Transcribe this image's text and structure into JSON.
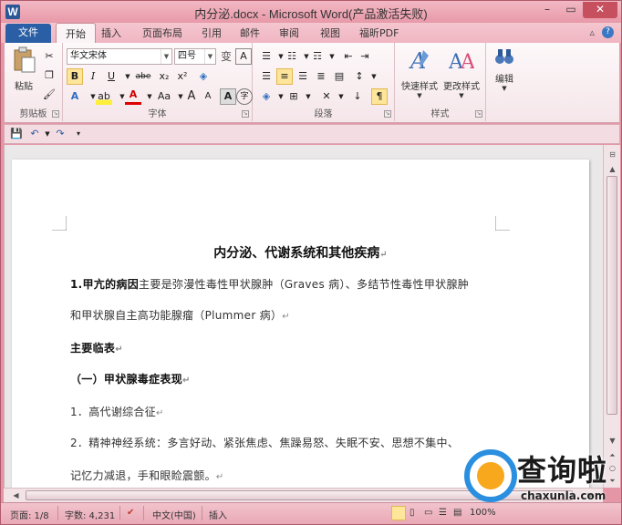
{
  "window": {
    "title": "内分泌.docx - Microsoft Word(产品激活失败)",
    "app_icon_letter": "W"
  },
  "tabs": {
    "file": "文件",
    "items": [
      "开始",
      "插入",
      "页面布局",
      "引用",
      "邮件",
      "审阅",
      "视图",
      "福昕PDF"
    ],
    "active": "开始"
  },
  "ribbon": {
    "clipboard": {
      "paste": "粘贴",
      "label": "剪贴板"
    },
    "font": {
      "family": "华文宋体",
      "size": "四号",
      "bold": "B",
      "italic": "I",
      "underline": "U",
      "strike": "abe",
      "subscript": "x₂",
      "superscript": "x²",
      "change_case": "Aa",
      "grow": "A",
      "shrink": "A",
      "label": "字体"
    },
    "paragraph": {
      "label": "段落"
    },
    "styles": {
      "quick": "快速样式",
      "change": "更改样式",
      "label": "样式"
    },
    "editing": {
      "label": "编辑"
    }
  },
  "document": {
    "title": "内分泌、代谢系统和其他疾病",
    "para1_bold": "1.甲亢的病因",
    "para1_rest": "主要是弥漫性毒性甲状腺肿（Graves 病）、多结节性毒性甲状腺肿",
    "para2": "和甲状腺自主高功能腺瘤（Plummer 病）",
    "heading1": "主要临表",
    "heading2": "（一）甲状腺毒症表现",
    "item1": "1．高代谢综合征",
    "item2": "2．精神神经系统：多言好动、紧张焦虑、焦躁易怒、失眠不安、思想不集中、",
    "item3": "记忆力减退，手和眼睑震颤。",
    "pilcrow": "↵"
  },
  "status": {
    "page": "页面: 1/8",
    "words": "字数: 4,231",
    "language": "中文(中国)",
    "mode": "插入",
    "zoom": "100%"
  },
  "watermark": {
    "text": "查询啦",
    "url": "chaxunla.com"
  },
  "colors": {
    "file_tab": "#2a5ea5",
    "chrome": "#e596a6",
    "watermark_blue": "#2b8fe0",
    "watermark_orange": "#f7a81c"
  }
}
